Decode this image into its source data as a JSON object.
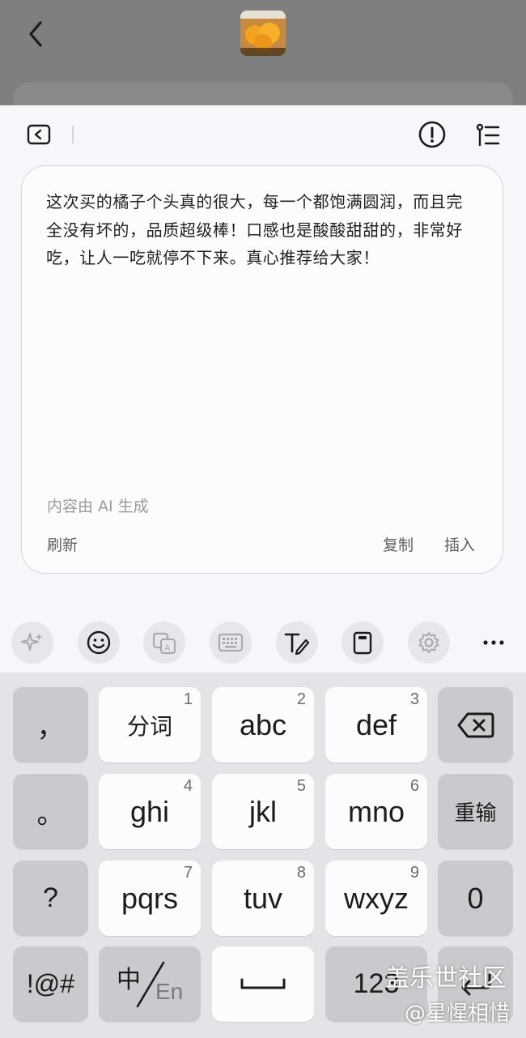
{
  "top": {
    "thumbnail_icon": "product-photo-oranges"
  },
  "ai_panel": {
    "generated_text": "这次买的橘子个头真的很大，每一个都饱满圆润，而且完全没有坏的，品质超级棒！口感也是酸酸甜甜的，非常好吃，让人一吃就停不下来。真心推荐给大家！",
    "ai_note": "内容由 AI 生成",
    "refresh_label": "刷新",
    "copy_label": "复制",
    "insert_label": "插入"
  },
  "toolbar": {
    "icons": [
      "sparkle-icon",
      "emoji-icon",
      "translate-icon",
      "keyboard-icon",
      "handwriting-icon",
      "clipboard-icon",
      "settings-icon",
      "more-icon"
    ]
  },
  "keyboard": {
    "row1": {
      "left": "，",
      "k1": {
        "label": "分词",
        "num": "1"
      },
      "k2": {
        "label": "abc",
        "num": "2"
      },
      "k3": {
        "label": "def",
        "num": "3"
      }
    },
    "row2": {
      "left": "。",
      "k1": {
        "label": "ghi",
        "num": "4"
      },
      "k2": {
        "label": "jkl",
        "num": "5"
      },
      "k3": {
        "label": "mno",
        "num": "6"
      },
      "right": "重输"
    },
    "row3": {
      "left": "?",
      "k1": {
        "label": "pqrs",
        "num": "7"
      },
      "k2": {
        "label": "tuv",
        "num": "8"
      },
      "k3": {
        "label": "wxyz",
        "num": "9"
      },
      "right": "0"
    },
    "row4": {
      "left": "!@#",
      "lang_cn": "中",
      "lang_en": "En",
      "num_key": "123"
    }
  },
  "watermark": {
    "line1": "盖乐世社区",
    "line2": "@星惺相惜"
  }
}
